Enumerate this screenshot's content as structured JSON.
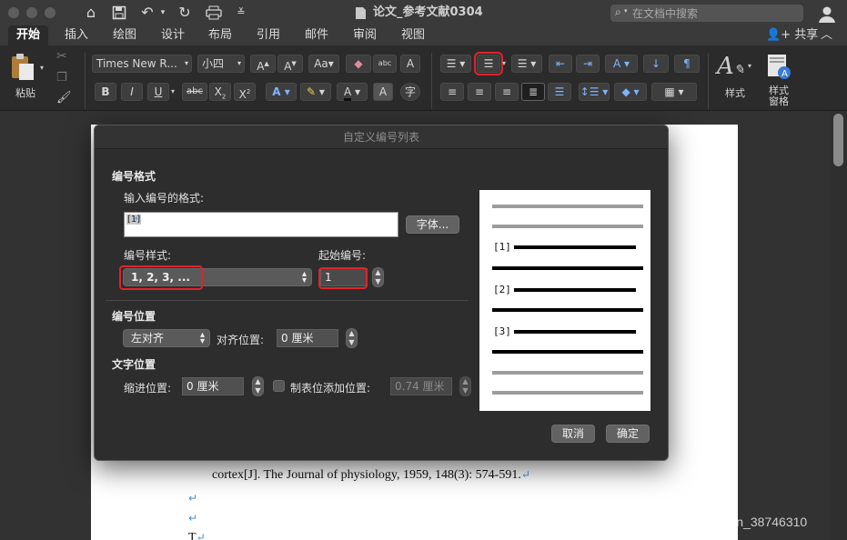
{
  "window": {
    "doc_title": "论文_参考文献0304"
  },
  "search": {
    "placeholder": "在文档中搜索"
  },
  "tabs": [
    {
      "label": "开始",
      "active": true
    },
    {
      "label": "插入"
    },
    {
      "label": "绘图"
    },
    {
      "label": "设计"
    },
    {
      "label": "布局"
    },
    {
      "label": "引用"
    },
    {
      "label": "邮件"
    },
    {
      "label": "审阅"
    },
    {
      "label": "视图"
    }
  ],
  "share": {
    "label": "共享"
  },
  "ribbon": {
    "paste_label": "粘贴",
    "font_name": "Times New R...",
    "font_size": "小四",
    "styles_label": "样式",
    "styles_pane_label_1": "样式",
    "styles_pane_label_2": "窗格",
    "bold": "B",
    "italic": "I",
    "underline": "U",
    "strikethrough": "abc",
    "subscript": "X",
    "superscript": "X",
    "text_effect": "A",
    "font_color": "A",
    "char_shading": "A",
    "enclose": "字"
  },
  "dialog": {
    "title": "自定义编号列表",
    "number_format_section": "编号格式",
    "enter_format_label": "输入编号的格式:",
    "format_value": "[1]",
    "font_button": "字体...",
    "number_style_label": "编号样式:",
    "number_style_value": "1, 2, 3, ...",
    "start_at_label": "起始编号:",
    "start_at_value": "1",
    "number_position_section": "编号位置",
    "alignment_value": "左对齐",
    "aligned_at_label": "对齐位置:",
    "aligned_at_value": "0 厘米",
    "text_position_section": "文字位置",
    "indent_at_label": "缩进位置:",
    "indent_at_value": "0 厘米",
    "tab_stop_label": "制表位添加位置:",
    "tab_stop_value": "0.74 厘米",
    "cancel_button": "取消",
    "ok_button": "确定",
    "preview_numbers": [
      "[1]",
      "[2]",
      "[3]"
    ]
  },
  "document": {
    "line1": "cortex[J]. The Journal of physiology, 1959, 148(3): 574-591.",
    "line_last": "T",
    "para_mark": "↵"
  },
  "watermark": "https://blog.csdn.net/weixin_38746310",
  "colors": {
    "highlight_red": "#e1232a",
    "accent_blue": "#4a8fd0"
  }
}
